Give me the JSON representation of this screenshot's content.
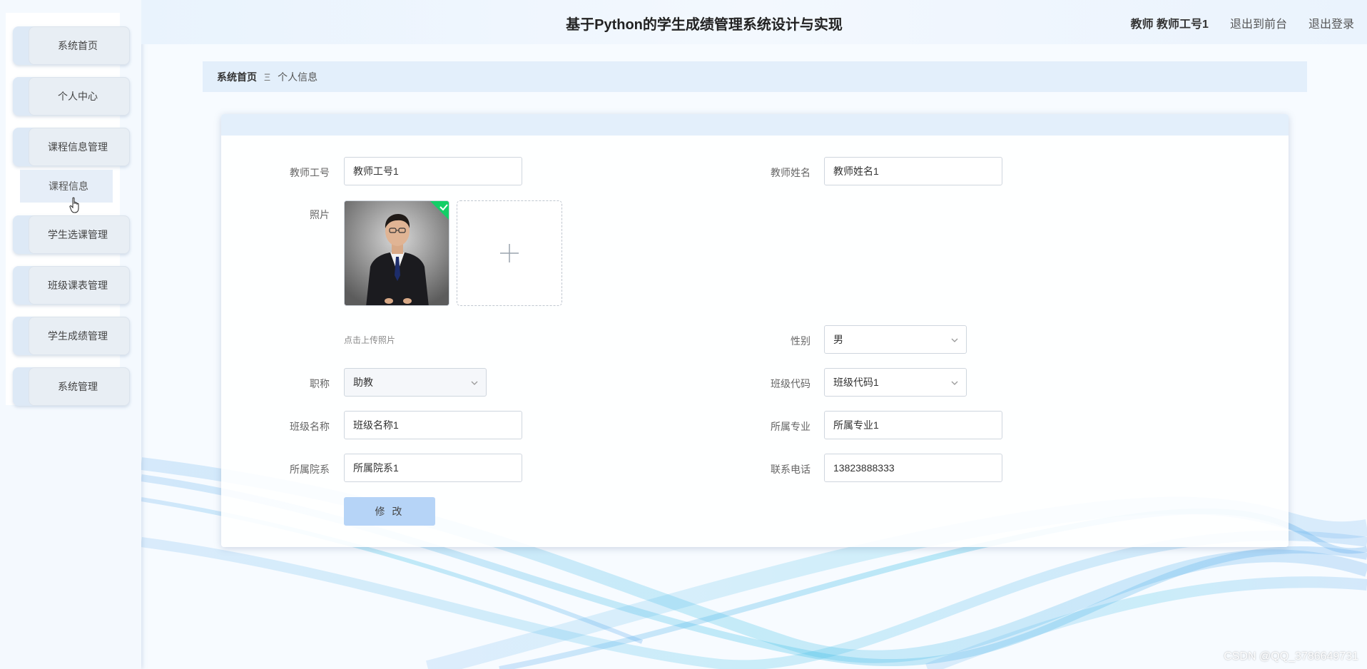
{
  "header": {
    "title": "基于Python的学生成绩管理系统设计与实现",
    "user": "教师 教师工号1",
    "front_link": "退出到前台",
    "logout_link": "退出登录"
  },
  "sidebar": {
    "items": [
      {
        "label": "系统首页"
      },
      {
        "label": "个人中心"
      },
      {
        "label": "课程信息管理"
      },
      {
        "label": "学生选课管理"
      },
      {
        "label": "班级课表管理"
      },
      {
        "label": "学生成绩管理"
      },
      {
        "label": "系统管理"
      }
    ],
    "submenu_label": "课程信息"
  },
  "breadcrumb": {
    "home": "系统首页",
    "separator": "Ξ",
    "current": "个人信息"
  },
  "form": {
    "teacher_id": {
      "label": "教师工号",
      "value": "教师工号1"
    },
    "teacher_name": {
      "label": "教师姓名",
      "value": "教师姓名1"
    },
    "photo": {
      "label": "照片",
      "hint": "点击上传照片"
    },
    "gender": {
      "label": "性别",
      "value": "男"
    },
    "title": {
      "label": "职称",
      "value": "助教"
    },
    "class_code": {
      "label": "班级代码",
      "value": "班级代码1"
    },
    "class_name": {
      "label": "班级名称",
      "value": "班级名称1"
    },
    "major": {
      "label": "所属专业",
      "value": "所属专业1"
    },
    "department": {
      "label": "所属院系",
      "value": "所属院系1"
    },
    "phone": {
      "label": "联系电话",
      "value": "13823888333"
    },
    "submit_label": "修 改"
  },
  "watermark": "CSDN @QQ_3786649731",
  "colors": {
    "accent_light": "#e3effb",
    "button": "#b6d4f7",
    "wave": "#4aa8e0"
  }
}
